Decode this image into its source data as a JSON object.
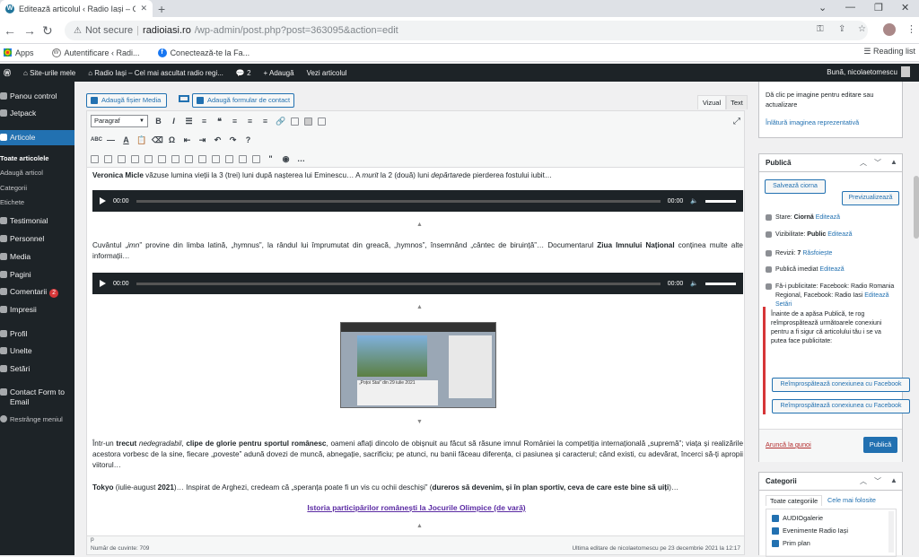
{
  "browser": {
    "tab_title": "Editează articolul ‹ Radio Iași – Ce",
    "not_secure": "Not secure",
    "url_host": "radioiasi.ro",
    "url_path": "/wp-admin/post.php?post=363095&action=edit",
    "bookmarks": [
      "Apps",
      "Autentificare ‹ Radi...",
      "Conectează-te la Fa..."
    ],
    "reading_list": "Reading list"
  },
  "adminbar": {
    "items": [
      "Site-urile mele",
      "Radio Iași – Cel mai ascultat radio regi...",
      "2",
      "Adaugă",
      "Vezi articolul"
    ],
    "greeting": "Bună, nicolaetomescu"
  },
  "sidebar": {
    "items": [
      "Panou control",
      "Jetpack",
      "Articole",
      "Toate articolele",
      "Adaugă articol",
      "Categorii",
      "Etichete",
      "Testimonial",
      "Personnel",
      "Media",
      "Pagini",
      "Comentarii",
      "Impresii",
      "Profil",
      "Unelte",
      "Setări",
      "Contact Form to Email",
      "Restrânge meniul"
    ],
    "comments_badge": "2"
  },
  "editor": {
    "add_media": "Adaugă fișier Media",
    "add_form": "Adaugă formular de contact",
    "tab_visual": "Vizual",
    "tab_text": "Text",
    "format_select": "Paragraf",
    "p1_bold": "Veronica Micle",
    "p1_a": " văzuse lumina vieții la 3 (trei) luni după nașterea lui Eminescu… A ",
    "p1_em1": "murit",
    "p1_b": " la 2 (două) luni ",
    "p1_em2": "depărtare",
    "p1_c": "de pierderea fostului iubit…",
    "time": "00:00",
    "p2_a": "Cuvântul „",
    "p2_em": "imn",
    "p2_b": "” provine din limba latină, „hymnus”, la rândul lui împrumutat din greacă, „hymnos”, însemnând „cântec de biruință”… Documentarul ",
    "p2_bold": "Ziua Imnului Național",
    "p2_c": " conținea multe alte informații…",
    "p3_a": "Într-un ",
    "p3_b1": "trecut",
    "p3_em": " nedegradabil",
    "p3_c": ", ",
    "p3_b2": "clipe de glorie pentru sportul românesc",
    "p3_d": ", oameni aflați dincolo de obișnuit au făcut să răsune imnul României la competiția internațională „supremă”; viața și realizările acestora vorbesc de la sine, fiecare „poveste” adună dovezi de muncă, abnegație, sacrificiu; pe atunci, nu banii făceau diferența, ci pasiunea și caracterul; când existi, cu adevărat, încerci să-ți apropii viitorul…",
    "p4_b": "Tokyo",
    "p4_a": " (iulie-august ",
    "p4_b2": "2021",
    "p4_c": ")… Inspirat de Arghezi, credeam că „speranța poate fi un vis cu ochii deschiși” (",
    "p4_b3": "dureros să devenim, și în plan sportiv, ceva de care este bine să uiți",
    "p4_d": ")…",
    "link": "Istoria participărilor românești la Jocurile Olimpice (de vară)",
    "thumb_caption": "„Poțoi Stai” din 29 iulie 2021",
    "path_p": "p",
    "word_count": "Număr de cuvinte: 709",
    "last_edit": "Ultima editare de nicolaetomescu pe 23 decembrie 2021 la 12:17"
  },
  "featured": {
    "hint": "Dă clic pe imagine pentru editare sau actualizare",
    "remove": "Înlătură imaginea reprezentativă"
  },
  "publish": {
    "title": "Publică",
    "save_draft": "Salvează ciorna",
    "preview": "Previzualizează",
    "status_label": "Stare: ",
    "status": "Ciornă",
    "visibility_label": "Vizibilitate: ",
    "visibility": "Public",
    "revisions_label": "Revizii: ",
    "revisions": "7",
    "browse": "Răsfoiește",
    "publish_when": "Publică imediat",
    "edit": "Editează",
    "share_label": "Fă-i publicitate: Facebook: Radio Romania Regional, Facebook: Radio Iasi",
    "settings": "Editează Setări",
    "notice": "Înainte de a apăsa Publică, te rog reîmprospătează următoarele conexiuni pentru a fi sigur că articolului tău i se va putea face publicitate:",
    "refresh_fb": "Reîmprospătează conexiunea cu Facebook",
    "trash": "Aruncă la gunoi",
    "publish_btn": "Publică"
  },
  "categories": {
    "title": "Categorii",
    "tab_all": "Toate categoriile",
    "tab_used": "Cele mai folosite",
    "items": [
      "AUDIOgalerie",
      "Evenimente Radio Iași",
      "Prim plan"
    ]
  }
}
